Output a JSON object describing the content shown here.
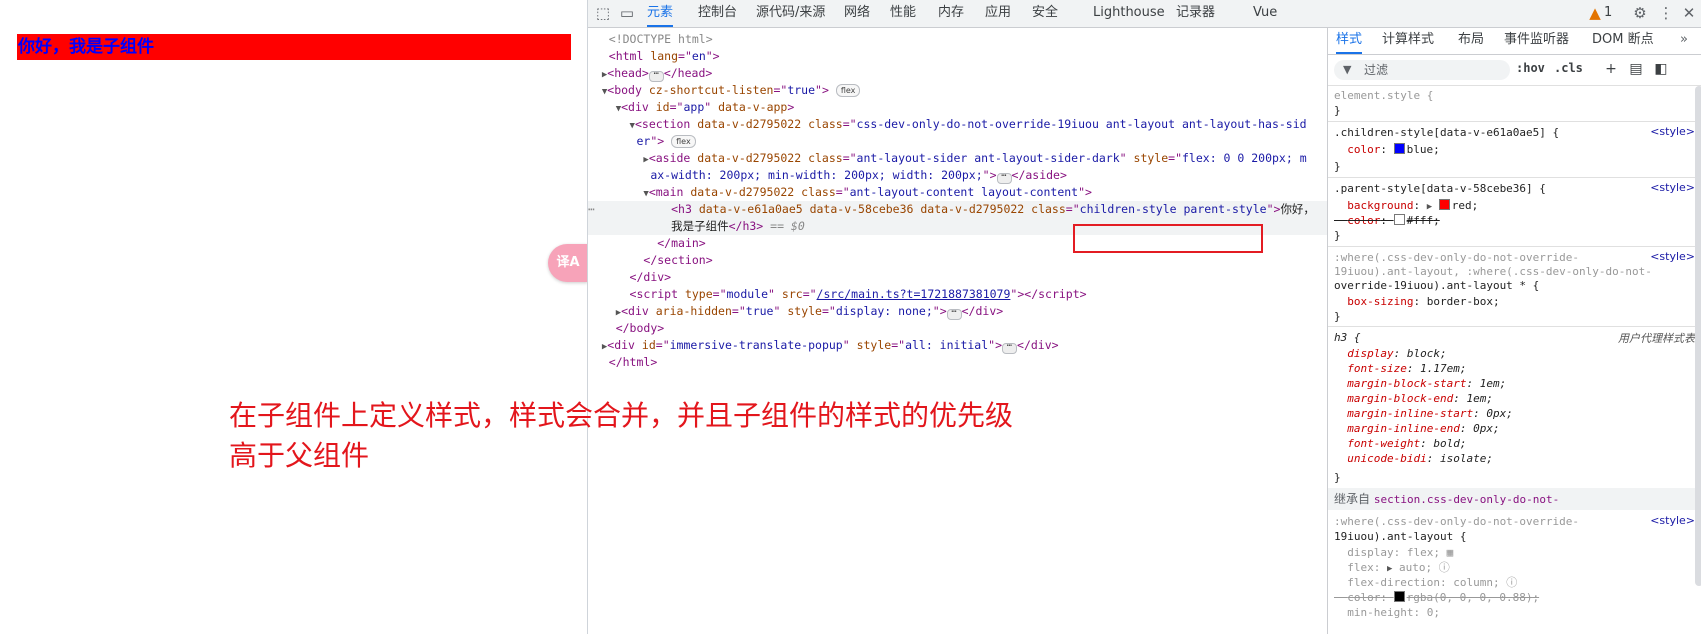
{
  "page": {
    "child_text": "你好，我是子组件",
    "translate_icon": "translate-icon",
    "annotation_line1": "在子组件上定义样式，样式会合并，并且子组件的样式的优先级",
    "annotation_line2": "高于父组件"
  },
  "devtools": {
    "tabs": [
      "元素",
      "控制台",
      "源代码/来源",
      "网络",
      "性能",
      "内存",
      "应用",
      "安全",
      "Lighthouse",
      "记录器",
      "Vue"
    ],
    "active_tab": "元素",
    "warning_count": "1",
    "elements": {
      "doctype": "<!DOCTYPE html>",
      "html_lang": "en",
      "body_attr": "cz-shortcut-listen",
      "body_attr_val": "true",
      "flex_badge": "flex",
      "app_id": "app",
      "app_attr": "data-v-app",
      "section_attr": "data-v-d2795022",
      "section_class": "css-dev-only-do-not-override-19iuou ant-layout ant-layout-has-sid",
      "section_class_cont": "er",
      "aside_class": "ant-layout-sider ant-layout-sider-dark",
      "aside_style": "flex: 0 0 200px; m",
      "aside_style_cont": "ax-width: 200px; min-width: 200px; width: 200px;",
      "main_class": "ant-layout-content layout-content",
      "h3_attrs": "data-v-e61a0ae5 data-v-58cebe36 data-v-d2795022",
      "h3_class": "children-style parent-style",
      "h3_text1": "你好，",
      "h3_text2": "我是子组件",
      "eq_dollar": " == $0",
      "script_type": "module",
      "script_src": "/src/main.ts?t=1721887381079",
      "hidden_aria": "true",
      "hidden_style": "display: none;",
      "popup_id": "immersive-translate-popup",
      "popup_style": "all: initial"
    },
    "styles": {
      "tabs": [
        "样式",
        "计算样式",
        "布局",
        "事件监听器",
        "DOM 断点"
      ],
      "active_tab": "样式",
      "filter_placeholder": "过滤",
      "hov": ":hov",
      "cls": ".cls",
      "element_style": "element.style {",
      "rule1_selector": ".children-style[data-v-e61a0ae5] {",
      "rule1_prop": "color",
      "rule1_val": "blue",
      "rule1_color": "#0000ff",
      "rule2_selector": ".parent-style[data-v-58cebe36] {",
      "rule2_prop": "background",
      "rule2_val": "red",
      "rule2_color": "#ff0000",
      "rule2_prop2": "color",
      "rule2_val2": "#fff",
      "rule3_sel_l1": ":where(.css-dev-only-do-not-override-",
      "rule3_sel_l2": "19iuou).ant-layout, :where(.css-dev-only-do-not-",
      "rule3_sel_l3": "override-19iuou).ant-layout * {",
      "rule3_prop": "box-sizing",
      "rule3_val": "border-box",
      "source": "<style>",
      "ua_label": "用户代理样式表",
      "h3_selector": "h3 {",
      "ua_props": [
        [
          "display",
          "block"
        ],
        [
          "font-size",
          "1.17em"
        ],
        [
          "margin-block-start",
          "1em"
        ],
        [
          "margin-block-end",
          "1em"
        ],
        [
          "margin-inline-start",
          "0px"
        ],
        [
          "margin-inline-end",
          "0px"
        ],
        [
          "font-weight",
          "bold"
        ],
        [
          "unicode-bidi",
          "isolate"
        ]
      ],
      "inherited_label": "继承自",
      "inherited_from": "section.css-dev-only-do-not-",
      "rule4_sel_l1": ":where(.css-dev-only-do-not-override-",
      "rule4_sel_l2": "19iuou).ant-layout {",
      "rule4_display": "flex",
      "rule4_flex": "auto",
      "rule4_flex_dir": "column",
      "rule4_color": "rgba(0, 0, 0, 0.88)",
      "rule4_minh": "0"
    }
  }
}
